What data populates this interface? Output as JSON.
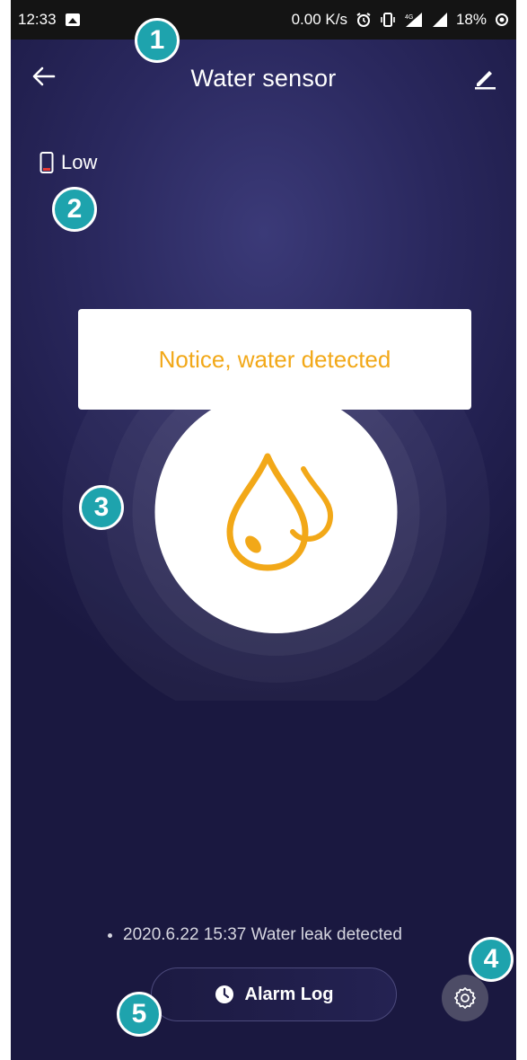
{
  "status_bar": {
    "time": "12:33",
    "network_speed": "0.00 K/s",
    "network_type": "4G",
    "battery_percent": "18%"
  },
  "header": {
    "title": "Water sensor"
  },
  "battery": {
    "label": "Low"
  },
  "alert": {
    "message": "Notice, water detected"
  },
  "log": {
    "entry": "2020.6.22 15:37 Water leak detected"
  },
  "buttons": {
    "alarm_log": "Alarm Log"
  },
  "badges": [
    "1",
    "2",
    "3",
    "4",
    "5"
  ],
  "colors": {
    "background": "#262456",
    "accent_orange": "#f2a818",
    "badge_teal": "#1ea3ad",
    "battery_low_red": "#e53935"
  },
  "icons": [
    "back-arrow-icon",
    "pencil-icon",
    "battery-icon",
    "water-drops-icon",
    "clock-icon",
    "gear-icon"
  ]
}
